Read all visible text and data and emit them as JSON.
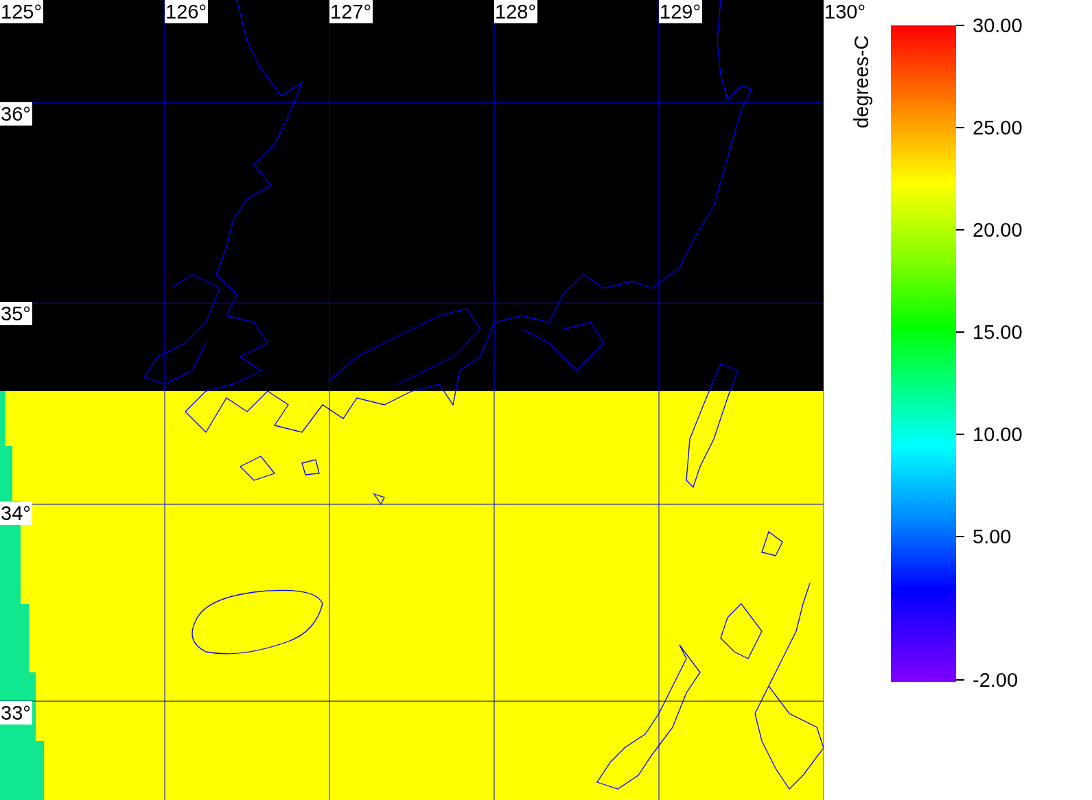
{
  "map": {
    "lon_labels": [
      "125°",
      "126°",
      "127°",
      "128°",
      "129°",
      "130°"
    ],
    "lat_labels": [
      "36°",
      "35°",
      "34°",
      "33°"
    ]
  },
  "colorbar": {
    "title": "degrees-C",
    "ticks": [
      "30.00",
      "25.00",
      "20.00",
      "15.00",
      "10.00",
      "5.00",
      "-2.00"
    ]
  }
}
